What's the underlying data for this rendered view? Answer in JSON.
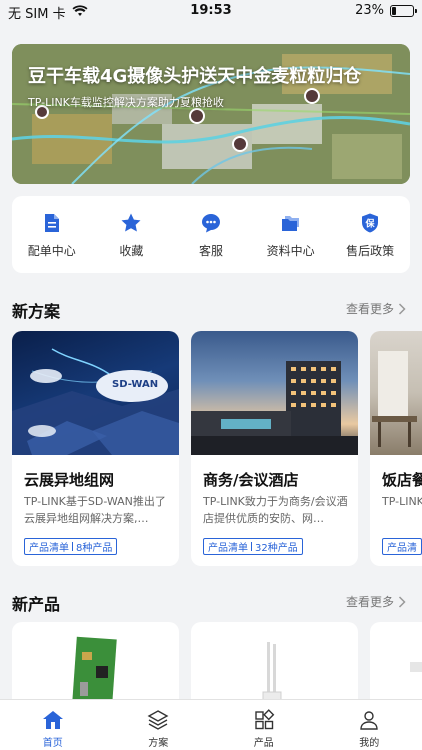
{
  "status": {
    "carrier": "无 SIM 卡",
    "time": "19:53",
    "battery": "23%",
    "battery_level": 0.23
  },
  "banner": {
    "title": "豆干车载4G摄像头护送天中金麦粒粒归仓",
    "subtitle": "TP-LINK车载监控解决方案助力夏粮抢收"
  },
  "quick": [
    {
      "label": "配单中心",
      "icon": "document-icon"
    },
    {
      "label": "收藏",
      "icon": "star-icon"
    },
    {
      "label": "客服",
      "icon": "chat-icon"
    },
    {
      "label": "资料中心",
      "icon": "folder-icon"
    },
    {
      "label": "售后政策",
      "icon": "shield-icon"
    }
  ],
  "solutions": {
    "title": "新方案",
    "more": "查看更多",
    "cards": [
      {
        "title": "云展异地组网",
        "desc": "TP-LINK基于SD-WAN推出了云展异地组网解决方案,…",
        "tag": "产品清单",
        "count": "8种产品",
        "img_text": "SD-WAN"
      },
      {
        "title": "商务/会议酒店",
        "desc": "TP-LINK致力于为商务/会议酒店提供优质的安防、网…",
        "tag": "产品清单",
        "count": "32种产品"
      },
      {
        "title": "饭店餐",
        "desc": "TP-LINK 供优质的",
        "tag": "产品清"
      }
    ]
  },
  "products": {
    "title": "新产品",
    "more": "查看更多"
  },
  "tabs": [
    {
      "label": "首页",
      "icon": "home-icon",
      "active": true
    },
    {
      "label": "方案",
      "icon": "layers-icon"
    },
    {
      "label": "产品",
      "icon": "grid-icon"
    },
    {
      "label": "我的",
      "icon": "user-icon"
    }
  ],
  "colors": {
    "accent": "#2a64d8",
    "background": "#f2f3f5"
  }
}
